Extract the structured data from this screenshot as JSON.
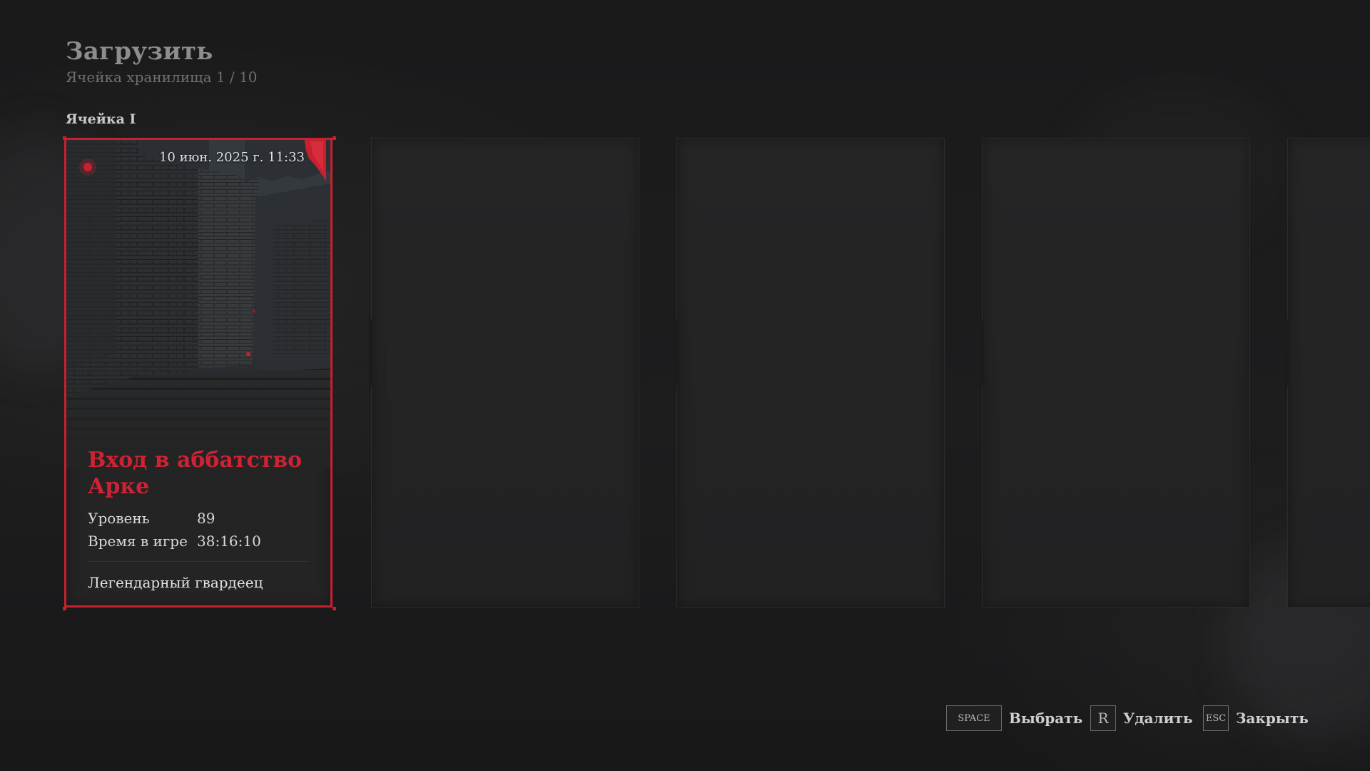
{
  "header": {
    "title": "Загрузить",
    "subtitle": "Ячейка хранилища 1 / 10"
  },
  "slot_group": {
    "label": "Ячейка I"
  },
  "slots": [
    {
      "state": "filled",
      "selected": true,
      "date": "10 июн. 2025 г. 11:33",
      "location": "Вход в аббатство Арке",
      "stats": [
        {
          "label": "Уровень",
          "value": "89"
        },
        {
          "label": "Время в игре",
          "value": "38:16:10"
        }
      ],
      "character_class": "Легендарный гвардеец"
    },
    {
      "state": "empty"
    },
    {
      "state": "empty"
    },
    {
      "state": "empty"
    },
    {
      "state": "empty"
    }
  ],
  "footer_hints": [
    {
      "key": "SPACE",
      "label": "Выбрать",
      "icon": "space-key-icon"
    },
    {
      "key": "R",
      "label": "Удалить",
      "icon": "r-key-icon"
    },
    {
      "key": "ESC",
      "label": "Закрыть",
      "icon": "esc-key-icon"
    }
  ],
  "colors": {
    "accent": "#c8202f",
    "location_title": "#cf2233",
    "background": "#1b1b1c",
    "card_empty": "#242425"
  }
}
